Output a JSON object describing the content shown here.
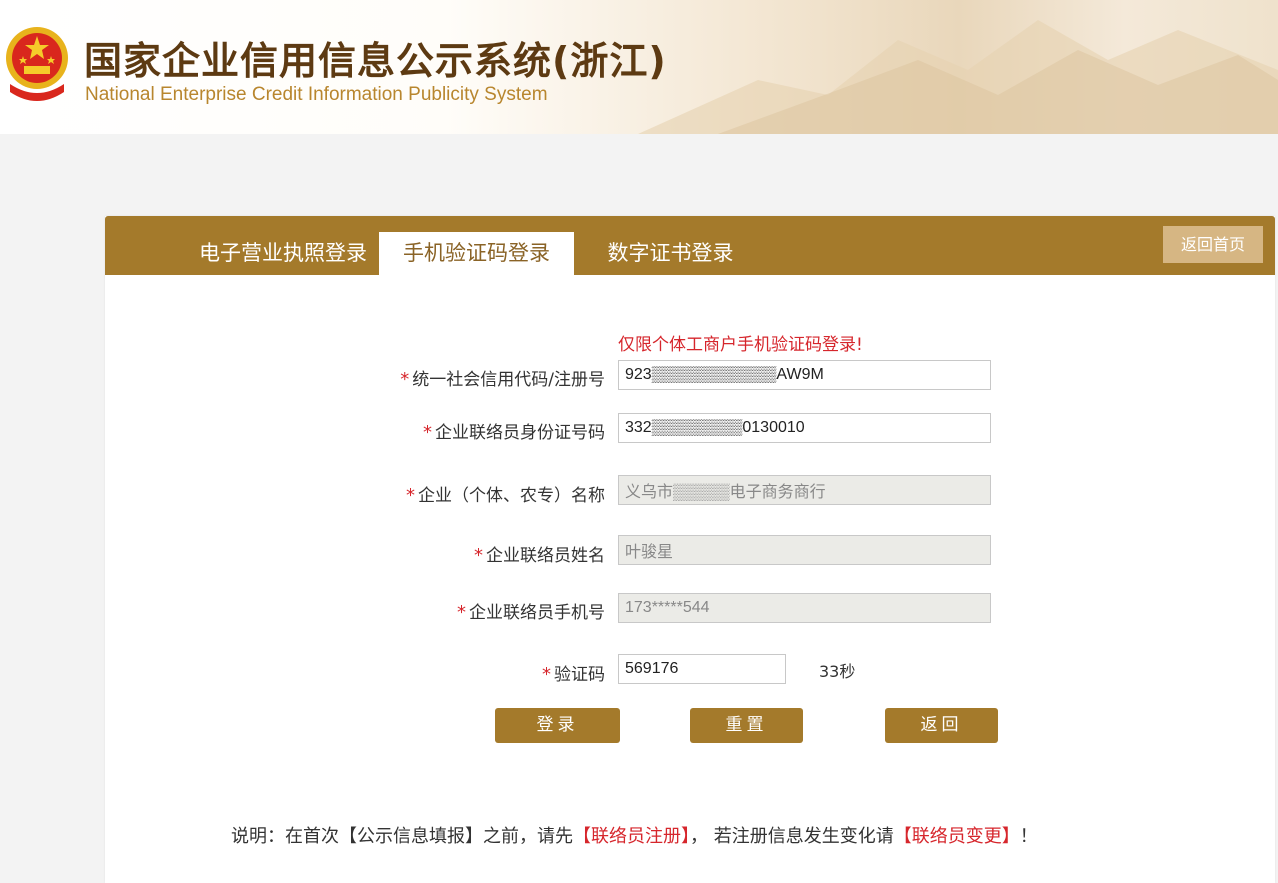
{
  "header": {
    "title_cn": "国家企业信用信息公示系统(浙江)",
    "title_en": "National Enterprise Credit Information Publicity System"
  },
  "tabs": [
    {
      "label": "电子营业执照登录",
      "active": false
    },
    {
      "label": "手机验证码登录",
      "active": true
    },
    {
      "label": "数字证书登录",
      "active": false
    }
  ],
  "home_button": "返回首页",
  "notice": "仅限个体工商户手机验证码登录!",
  "form": {
    "required_mark": "*",
    "credit_code": {
      "label": "统一社会信用代码/注册号",
      "value": "923▒▒▒▒▒▒▒▒▒▒▒AW9M"
    },
    "id_number": {
      "label": "企业联络员身份证号码",
      "value": "332▒▒▒▒▒▒▒▒0130010"
    },
    "enterprise_name": {
      "label": "企业（个体、农专）名称",
      "value": "义乌市▒▒▒▒▒电子商务商行"
    },
    "contact_name": {
      "label": "企业联络员姓名",
      "value": "叶骏星"
    },
    "contact_phone": {
      "label": "企业联络员手机号",
      "value": "173*****544"
    },
    "verify_code": {
      "label": "验证码",
      "value": "569176"
    },
    "countdown": "33秒"
  },
  "buttons": {
    "login": "登录",
    "reset": "重置",
    "back": "返回"
  },
  "footer": {
    "prefix": "说明：在首次【公示信息填报】之前，请先",
    "link1": "【联络员注册】",
    "middle": "，  若注册信息发生变化请",
    "link2": "【联络员变更】",
    "suffix": "！"
  },
  "colors": {
    "brand_gold": "#a47a2b",
    "required_red": "#d6262c"
  }
}
